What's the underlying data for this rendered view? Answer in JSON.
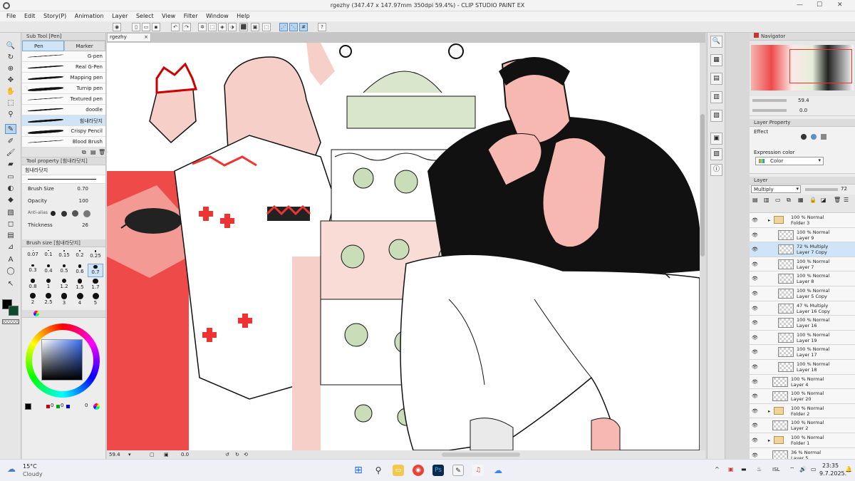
{
  "window": {
    "title": "rgezhy (347.47 x 147.97mm 350dpi 59.4%) - CLIP STUDIO PAINT EX",
    "minimize": "—",
    "maximize": "☐",
    "close": "✕"
  },
  "menu": [
    "File",
    "Edit",
    "Story(P)",
    "Animation",
    "Layer",
    "Select",
    "View",
    "Filter",
    "Window",
    "Help"
  ],
  "sub_tool_panel": {
    "title": "Sub Tool [Pen]",
    "tabs": [
      "Pen",
      "Marker"
    ],
    "brushes": [
      "G-pen",
      "Real G-Pen",
      "Mapping pen",
      "Turnip pen",
      "Textured pen",
      "doodle",
      "힘내라닷지",
      "Crispy Pencil",
      "Blood Brush"
    ],
    "selected_brush_index": 6
  },
  "tool_property_panel": {
    "title": "Tool property [힘내라닷지]",
    "brush_name": "힘내라닷지",
    "brush_size_label": "Brush Size",
    "brush_size_value": "0.70",
    "opacity_label": "Opacity",
    "opacity_value": "100",
    "anti_alias_label": "Anti-alias",
    "thickness_label": "Thickness",
    "thickness_value": "26"
  },
  "brush_size_panel": {
    "title": "Brush size [힘내라닷지]",
    "sizes": [
      "0.07",
      "0.1",
      "0.15",
      "0.2",
      "0.25",
      "0.3",
      "0.4",
      "0.5",
      "0.6",
      "0.7",
      "0.8",
      "1",
      "1.2",
      "1.5",
      "1.7",
      "2",
      "2.5",
      "3",
      "4",
      "5"
    ],
    "selected_index": 9
  },
  "color_panel": {
    "swatch_values": [
      "0",
      "0",
      "0"
    ]
  },
  "canvas": {
    "doc_tab": "rgezhy",
    "zoom": "59.4",
    "rotation": "0.0"
  },
  "navigator": {
    "title": "Navigator",
    "zoom": "59.4",
    "rotation": "0.0"
  },
  "layer_property": {
    "title": "Layer Property",
    "effect_label": "Effect",
    "expression_label": "Expression color",
    "expression_value": "Color"
  },
  "layer_panel": {
    "title": "Layer",
    "blend_mode": "Multiply",
    "opacity": "72",
    "layers": [
      {
        "line1": "100 % Normal",
        "line2": "Folder 3",
        "folder": true,
        "indent": 0
      },
      {
        "line1": "100 % Normal",
        "line2": "Layer 9",
        "folder": false,
        "indent": 1
      },
      {
        "line1": "72 % Multiply",
        "line2": "Layer 7 Copy",
        "folder": false,
        "indent": 1,
        "selected": true
      },
      {
        "line1": "100 % Normal",
        "line2": "Layer 7",
        "folder": false,
        "indent": 1
      },
      {
        "line1": "100 % Normal",
        "line2": "Layer 8",
        "folder": false,
        "indent": 1
      },
      {
        "line1": "100 % Normal",
        "line2": "Layer 5 Copy",
        "folder": false,
        "indent": 1
      },
      {
        "line1": "47 % Multiply",
        "line2": "Layer 16 Copy",
        "folder": false,
        "indent": 1
      },
      {
        "line1": "100 % Normal",
        "line2": "Layer 16",
        "folder": false,
        "indent": 1
      },
      {
        "line1": "100 % Normal",
        "line2": "Layer 19",
        "folder": false,
        "indent": 1
      },
      {
        "line1": "100 % Normal",
        "line2": "Layer 17",
        "folder": false,
        "indent": 1
      },
      {
        "line1": "100 % Normal",
        "line2": "Layer 18",
        "folder": false,
        "indent": 1
      },
      {
        "line1": "100 % Normal",
        "line2": "Layer 4",
        "folder": false,
        "indent": 0
      },
      {
        "line1": "100 % Normal",
        "line2": "Layer 20",
        "folder": false,
        "indent": 0
      },
      {
        "line1": "100 % Normal",
        "line2": "Folder 2",
        "folder": true,
        "indent": 0
      },
      {
        "line1": "100 % Normal",
        "line2": "Layer 2",
        "folder": false,
        "indent": 0
      },
      {
        "line1": "100 % Normal",
        "line2": "Folder 1",
        "folder": true,
        "indent": 0
      },
      {
        "line1": "36 % Normal",
        "line2": "Layer 5",
        "folder": false,
        "indent": 0
      }
    ]
  },
  "taskbar": {
    "weather_temp": "15°C",
    "weather_desc": "Cloudy",
    "language": "ISL",
    "time": "23:35",
    "date": "9.7.2025."
  },
  "colors": {
    "accent_blue": "#5b8fc7",
    "selection": "#cfe4f7",
    "art_red": "#ee4a4a",
    "art_pink": "#f6cfc9",
    "art_green": "#d9e6cc"
  }
}
